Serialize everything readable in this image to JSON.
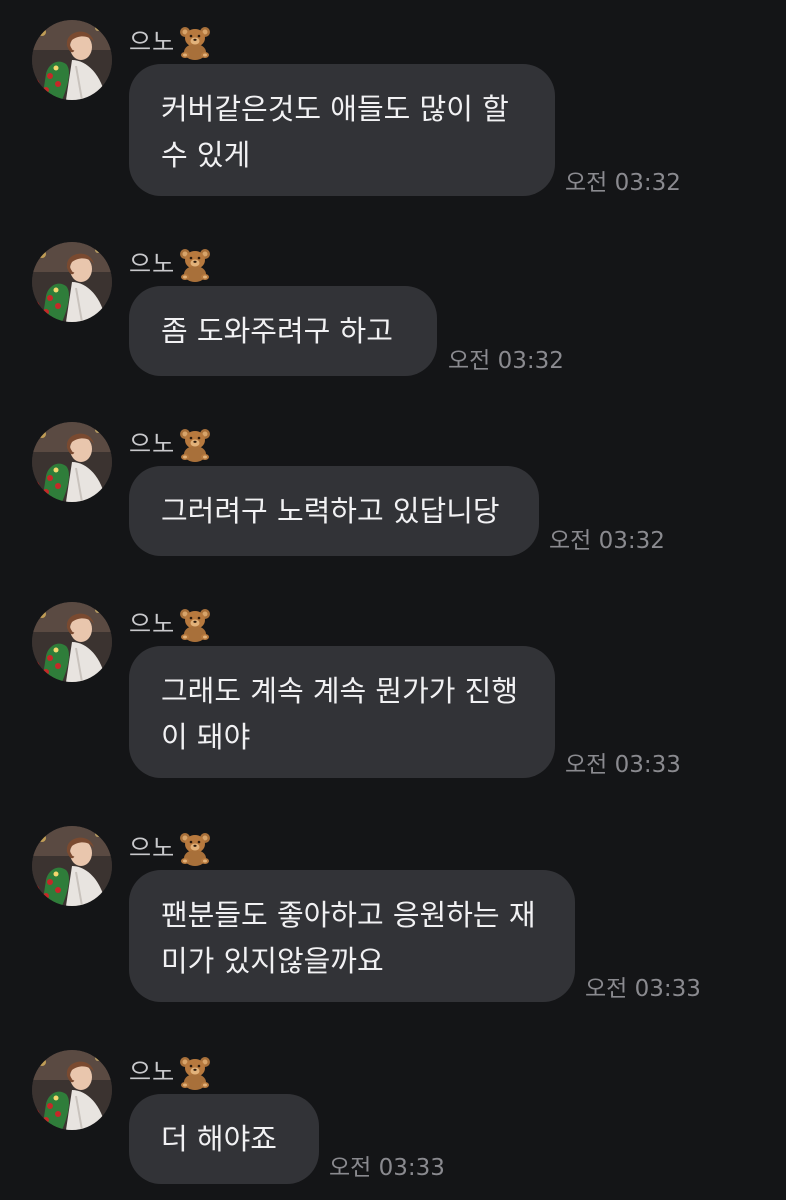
{
  "sender_name": "으노",
  "name_emoji": "teddy-bear",
  "colors": {
    "background": "#141517",
    "bubble": "#323337",
    "message_text": "#f1f1f3",
    "timestamp": "#8a8a8f",
    "name": "#c9c9cc"
  },
  "messages": [
    {
      "text": "커버같은것도 애들도 많이 할\n수 있게",
      "time": "오전 03:32"
    },
    {
      "text": "좀 도와주려구 하고",
      "time": "오전 03:32"
    },
    {
      "text": "그러려구 노력하고 있답니당",
      "time": "오전 03:32"
    },
    {
      "text": "그래도 계속 계속 뭔가가 진행\n이 돼야",
      "time": "오전 03:33"
    },
    {
      "text": "팬분들도 좋아하고 응원하는 재\n미가 있지않을까요",
      "time": "오전 03:33"
    },
    {
      "text": "더 해야죠",
      "time": "오전 03:33"
    }
  ]
}
